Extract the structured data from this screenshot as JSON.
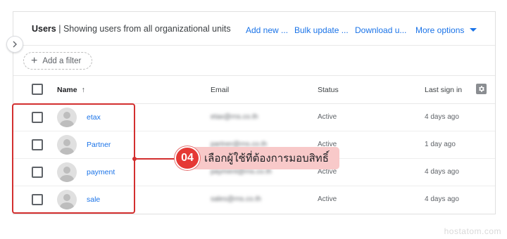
{
  "header": {
    "title_strong": "Users",
    "title_rest": "| Showing users from all organizational units",
    "actions": {
      "add_new": "Add new ...",
      "bulk_update": "Bulk update ...",
      "download": "Download u...",
      "more_options": "More options"
    }
  },
  "filter": {
    "add_label": "Add a filter"
  },
  "table": {
    "columns": {
      "name": "Name",
      "email": "Email",
      "status": "Status",
      "last_sign_in": "Last sign in"
    },
    "sort_indicator": "↑",
    "rows": [
      {
        "name": "etax",
        "email": "etax@rns.co.th",
        "status": "Active",
        "last_sign_in": "4 days ago"
      },
      {
        "name": "Partner",
        "email": "partner@rns.co.th",
        "status": "Active",
        "last_sign_in": "1 day ago"
      },
      {
        "name": "payment",
        "email": "payment@rns.co.th",
        "status": "Active",
        "last_sign_in": "4 days ago"
      },
      {
        "name": "sale",
        "email": "sales@rns.co.th",
        "status": "Active",
        "last_sign_in": "4 days ago"
      }
    ]
  },
  "annotation": {
    "step_number": "04",
    "text": "เลือกผู้ใช้ที่ต้องการมอบสิทธิ์"
  },
  "watermark": "hostatom.com",
  "colors": {
    "link": "#1a73e8",
    "annotation_red": "#d32f2f",
    "callout_bg": "#f8c9c9"
  },
  "icons": {
    "collapse": "chevron-right-icon",
    "filter_add": "plus-icon",
    "settings": "gear-icon",
    "avatar": "person-avatar-icon",
    "more_options": "caret-down-icon"
  }
}
